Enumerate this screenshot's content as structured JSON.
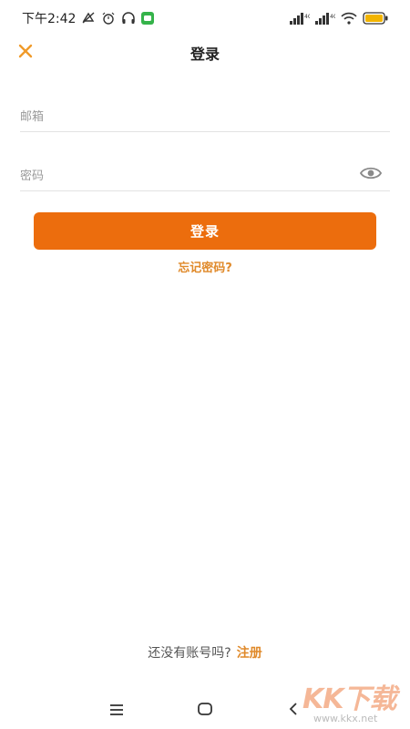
{
  "status_bar": {
    "time": "下午2:42",
    "icons": [
      "notification-off-icon",
      "alarm-icon",
      "headset-icon",
      "chat-app-icon",
      "signal-icon",
      "signal-icon",
      "wifi-icon",
      "battery-icon"
    ]
  },
  "header": {
    "title": "登录",
    "close_icon": "close-icon"
  },
  "form": {
    "email_placeholder": "邮箱",
    "password_placeholder": "密码",
    "password_toggle_icon": "eye-icon",
    "login_label": "登录",
    "forgot_label": "忘记密码?"
  },
  "footer": {
    "prompt": "还没有账号吗?",
    "signup_label": "注册"
  },
  "system_nav": {
    "icons": [
      "menu-icon",
      "home-icon",
      "back-icon"
    ]
  },
  "watermark": {
    "logo": "KK下载",
    "url": "www.kkx.net"
  },
  "colors": {
    "accent": "#ec6d0d",
    "link": "#e08a2b",
    "close": "#f09a2a"
  }
}
